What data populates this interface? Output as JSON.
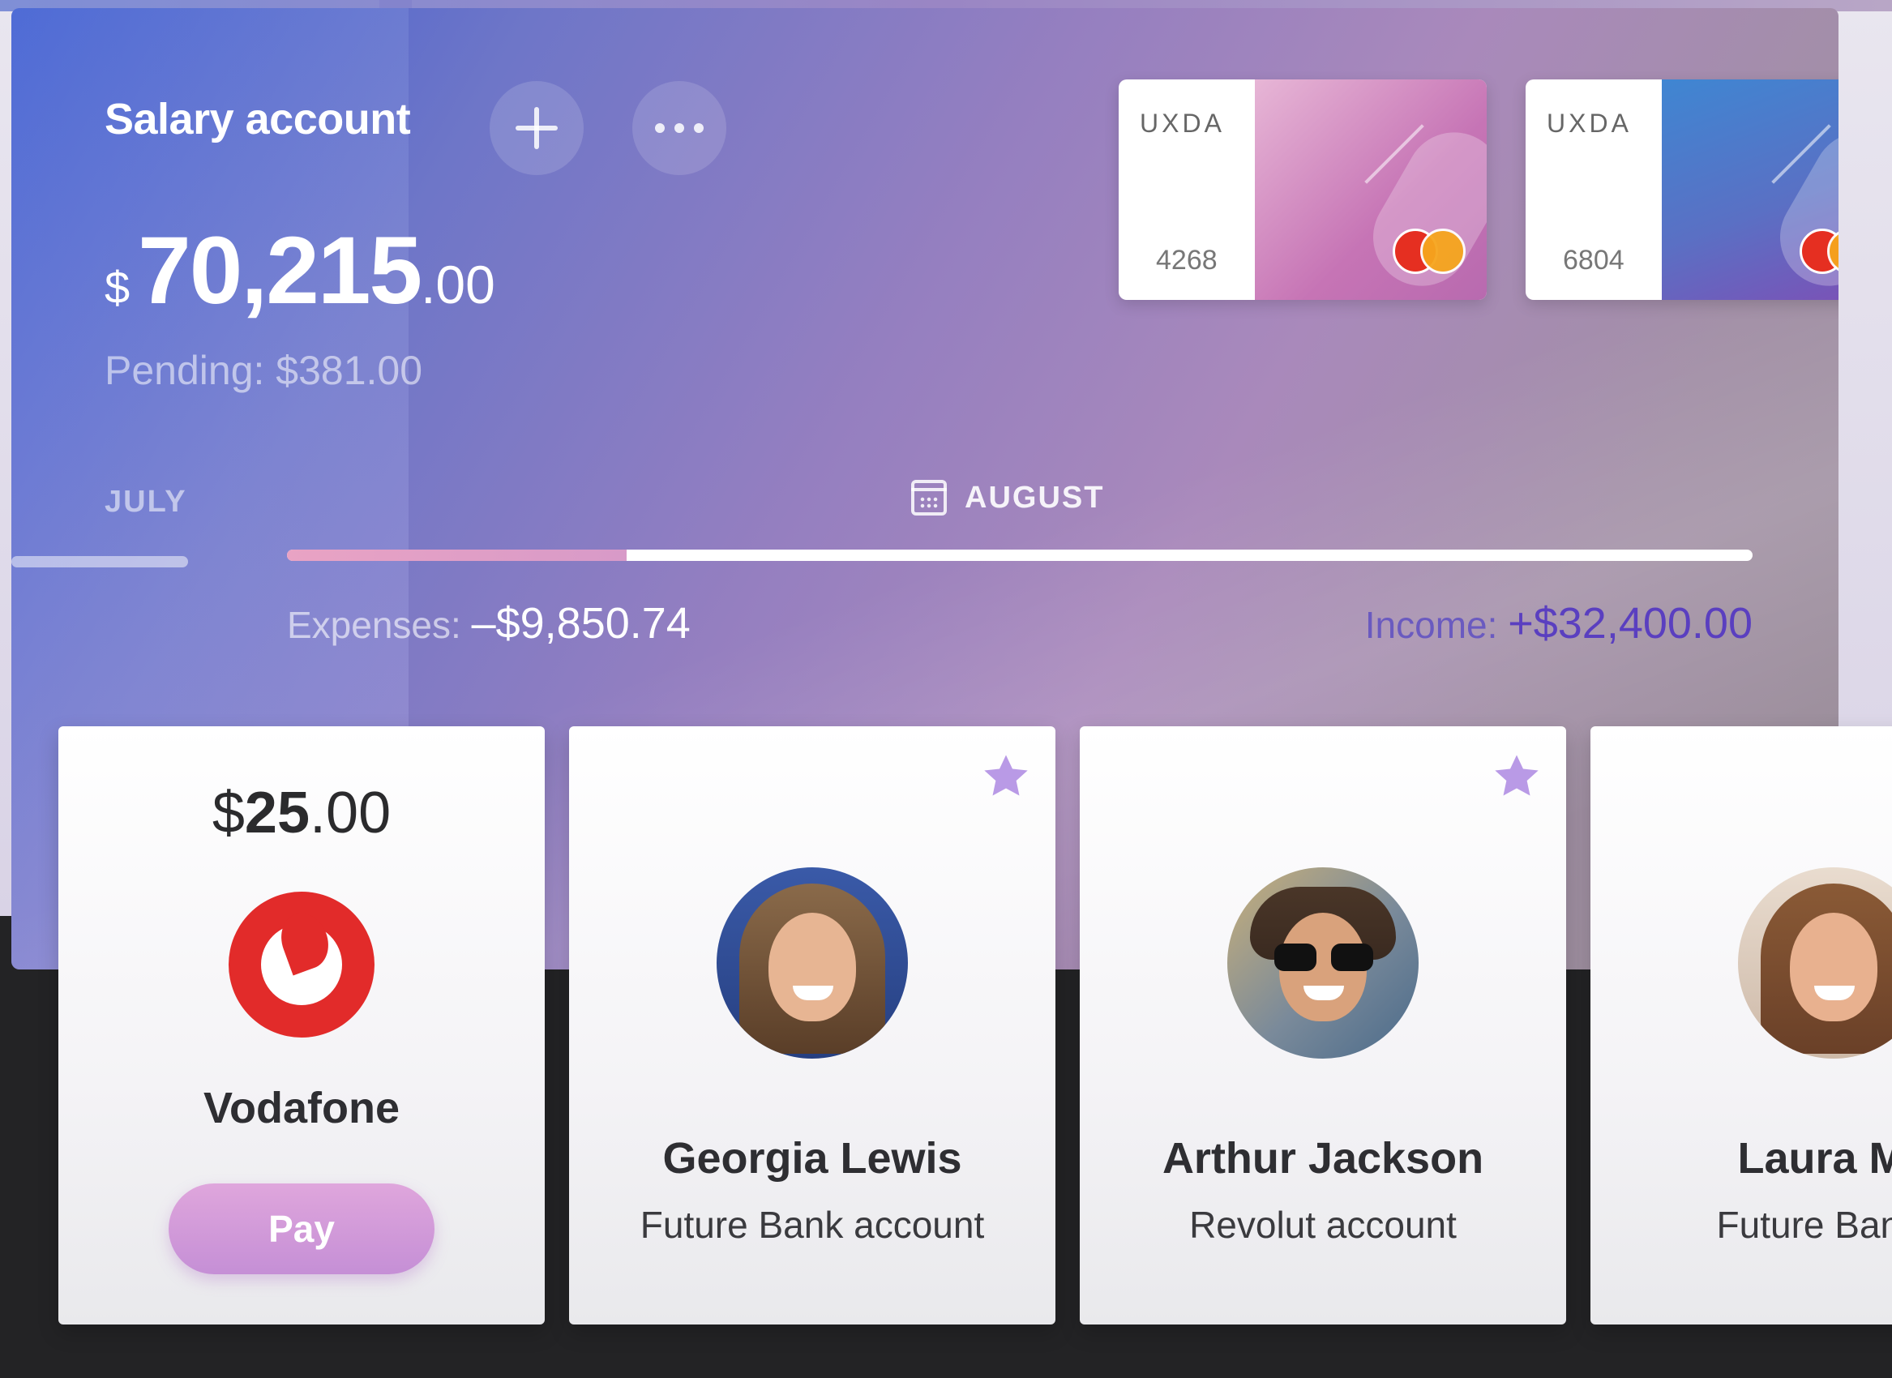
{
  "account": {
    "title": "Salary account",
    "currency": "$",
    "balance_main": "70,215",
    "balance_cents": ".00",
    "pending": "Pending: $381.00"
  },
  "cards": [
    {
      "brand": "UXDA",
      "last4": "4268",
      "color": "#c879b6"
    },
    {
      "brand": "UXDA",
      "last4": "6804",
      "color": "#4f6fc9"
    }
  ],
  "months": {
    "previous": "JULY",
    "current": "AUGUST"
  },
  "progress": {
    "spent_fraction": 0.232
  },
  "summary": {
    "expenses_label": "Expenses:",
    "expenses_value": "–$9,850.74",
    "income_label": "Income:",
    "income_value": "+$32,400.00"
  },
  "tiles": [
    {
      "type": "bill",
      "amount_currency": "$",
      "amount_main": "25",
      "amount_cents": ".00",
      "name": "Vodafone",
      "action": "Pay"
    },
    {
      "type": "contact",
      "name": "Georgia Lewis",
      "account": "Future Bank account",
      "favorite": true
    },
    {
      "type": "contact",
      "name": "Arthur Jackson",
      "account": "Revolut account",
      "favorite": true
    },
    {
      "type": "contact",
      "name": "Laura Ma",
      "account": "Future Bank a",
      "favorite": false
    }
  ],
  "colors": {
    "star": "#b99ae6",
    "pay": "#d49cda",
    "income": "#5a3fc0"
  }
}
